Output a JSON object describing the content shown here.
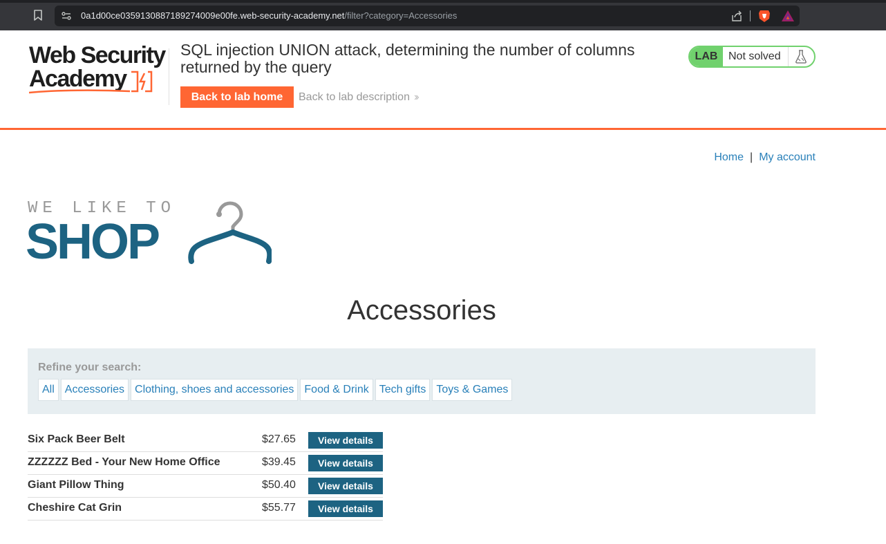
{
  "browser": {
    "url_host": "0a1d00ce0359130887189274009e00fe.web-security-academy.net",
    "url_path": "/filter?category=Accessories"
  },
  "academy": {
    "logo_line1": "Web Security",
    "logo_line2": "Academy",
    "lab_title": "SQL injection UNION attack, determining the number of columns returned by the query",
    "back_home": "Back to lab home",
    "back_description": "Back to lab description",
    "lab_badge": "LAB",
    "lab_status": "Not solved"
  },
  "nav": {
    "home": "Home",
    "separator": "|",
    "my_account": "My account"
  },
  "shop_logo": {
    "tagline": "WE LIKE TO",
    "word": "SHOP"
  },
  "page_title": "Accessories",
  "filters": {
    "label": "Refine your search:",
    "categories": [
      "All",
      "Accessories",
      "Clothing, shoes and accessories",
      "Food & Drink",
      "Tech gifts",
      "Toys & Games"
    ]
  },
  "products": [
    {
      "name": "Six Pack Beer Belt",
      "price": "$27.65",
      "button": "View details"
    },
    {
      "name": "ZZZZZZ Bed - Your New Home Office",
      "price": "$39.45",
      "button": "View details"
    },
    {
      "name": "Giant Pillow Thing",
      "price": "$50.40",
      "button": "View details"
    },
    {
      "name": "Cheshire Cat Grin",
      "price": "$55.77",
      "button": "View details"
    }
  ],
  "colors": {
    "accent_orange": "#ff6633",
    "brand_blue": "#1d6382",
    "link_blue": "#2980b9",
    "lab_green": "#70d16d",
    "panel_bg": "#e7eef1"
  }
}
